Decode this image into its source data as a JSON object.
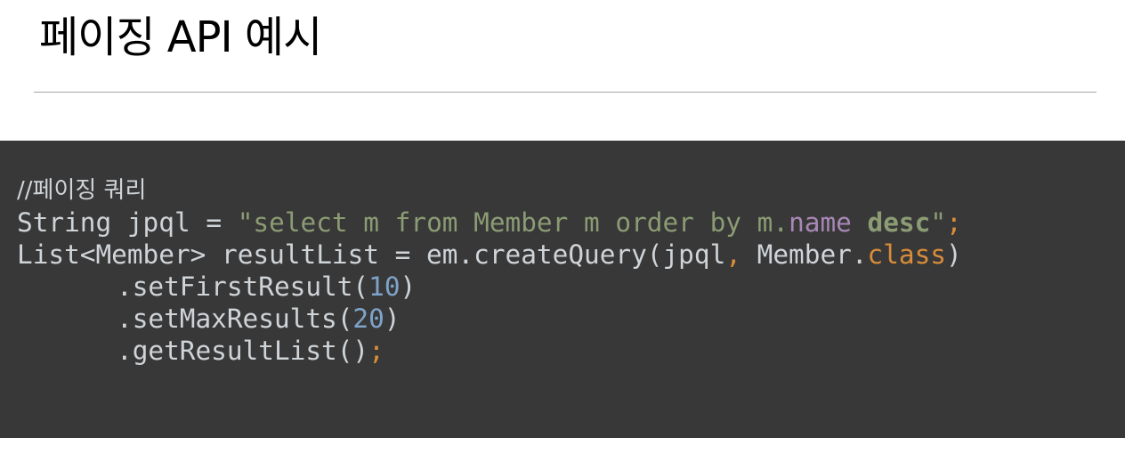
{
  "title": "페이징 API 예시",
  "code": {
    "comment": "//페이징 쿼리",
    "line2": {
      "prefix": "String jpql = ",
      "string_a": "\"select m from Member m order by m.",
      "field": "name",
      "space": " ",
      "keyword": "desc",
      "string_end": "\"",
      "semicolon": ";"
    },
    "line3": {
      "prefix": "List<Member> resultList = em.createQuery(jpql",
      "comma": ",",
      "middle": " Member.",
      "keyword": "class",
      "close": ")"
    },
    "line4": {
      "method": ".setFirstResult(",
      "number": "10",
      "close": ")"
    },
    "line5": {
      "method": ".setMaxResults(",
      "number": "20",
      "close": ")"
    },
    "line6": {
      "method": ".getResultList()",
      "semicolon": ";"
    }
  },
  "colors": {
    "code_background": "#383838",
    "code_text": "#cfd4d8",
    "string": "#8b9c74",
    "field": "#a887b6",
    "keyword_orange": "#d98c3a",
    "number": "#7ea3c9",
    "rule": "#a6a6a6"
  }
}
